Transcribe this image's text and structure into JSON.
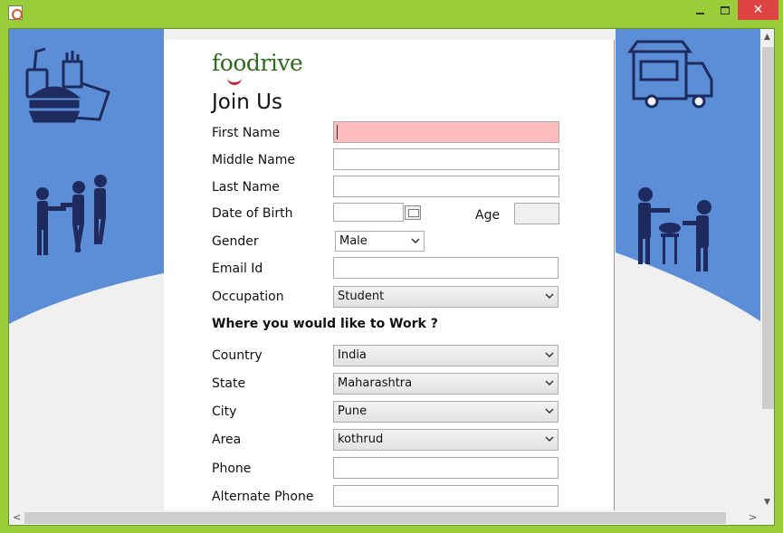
{
  "window": {
    "icon": "java-cup-icon",
    "minimize_icon": "minimize-icon",
    "maximize_icon": "maximize-icon",
    "close_label": "✕"
  },
  "colors": {
    "window_frame": "#9ACD3A",
    "banner_blue": "#5B8ED6",
    "icon_navy": "#1F2A5E",
    "logo_green": "#2E6B1E",
    "logo_red": "#C0272D",
    "required_field": "#FFBCBC"
  },
  "decor": {
    "left_icons": [
      "fast-food-icon",
      "people-handshake-icon"
    ],
    "right_icons": [
      "food-truck-icon",
      "street-vendor-icon"
    ]
  },
  "form": {
    "logo_prefix": "f",
    "logo_oo": "oo",
    "logo_suffix": "drive",
    "title": "Join Us",
    "first_name": {
      "label": "First Name",
      "value": ""
    },
    "middle_name": {
      "label": "Middle Name",
      "value": ""
    },
    "last_name": {
      "label": "Last Name",
      "value": ""
    },
    "dob": {
      "label": "Date of Birth",
      "value": "",
      "calendar_icon": "calendar-icon"
    },
    "age": {
      "label": "Age",
      "value": ""
    },
    "gender": {
      "label": "Gender",
      "selected": "Male"
    },
    "email": {
      "label": "Email Id",
      "value": ""
    },
    "occupation": {
      "label": "Occupation",
      "selected": "Student"
    },
    "work_section_title": "Where you would like to Work ?",
    "country": {
      "label": "Country",
      "selected": "India"
    },
    "state": {
      "label": "State",
      "selected": "Maharashtra"
    },
    "city": {
      "label": "City",
      "selected": "Pune"
    },
    "area": {
      "label": "Area",
      "selected": "kothrud"
    },
    "phone": {
      "label": "Phone",
      "value": ""
    },
    "alt_phone": {
      "label": "Alternate Phone",
      "value": ""
    }
  }
}
